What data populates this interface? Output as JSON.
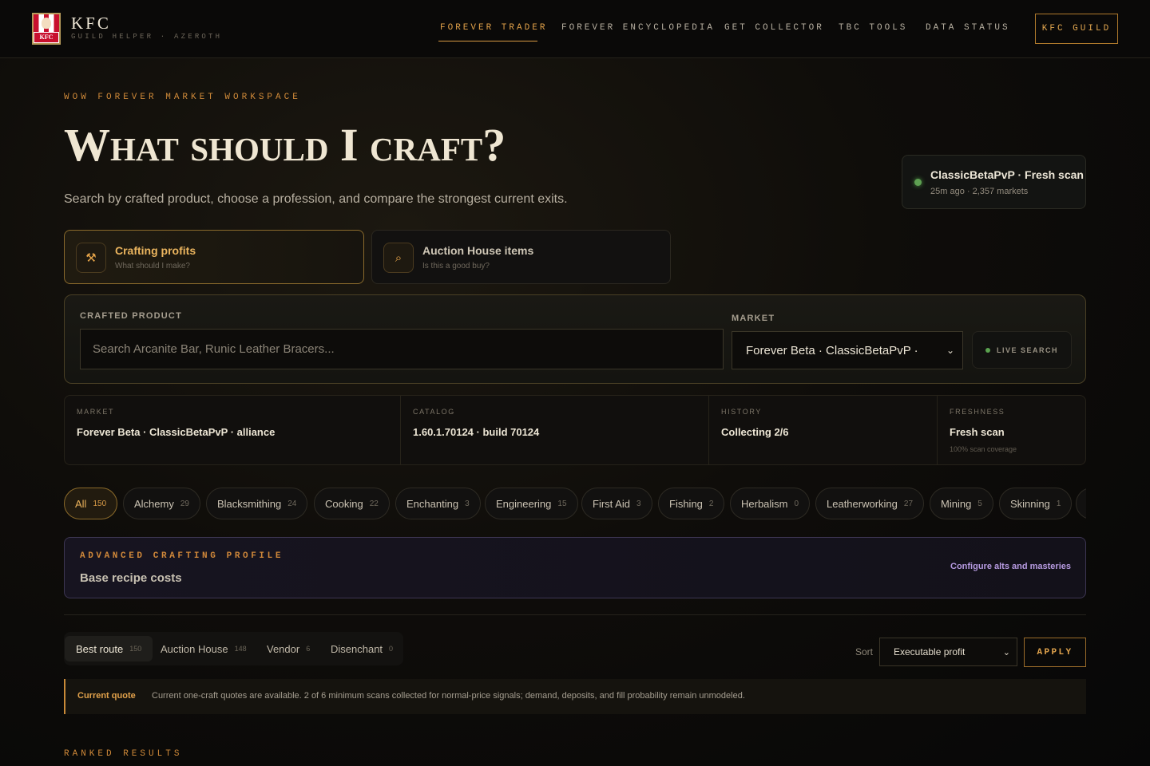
{
  "brand": {
    "logo_text": "KFC",
    "name": "KFC",
    "tagline": "GUILD HELPER · AZEROTH"
  },
  "nav": {
    "items": [
      {
        "label": "FOREVER TRADER",
        "active": true
      },
      {
        "label": "FOREVER ENCYCLOPEDIA",
        "active": false
      },
      {
        "label": "GET COLLECTOR",
        "active": false
      },
      {
        "label": "TBC TOOLS",
        "active": false
      },
      {
        "label": "DATA STATUS",
        "active": false
      }
    ],
    "guild_button": "KFC GUILD"
  },
  "hero": {
    "eyebrow": "WOW FOREVER MARKET WORKSPACE",
    "title": "What should I craft?",
    "subtitle": "Search by crafted product, choose a profession, and compare the strongest current exits."
  },
  "scan_status": {
    "title": "ClassicBetaPvP · Fresh scan",
    "meta": "25m ago · 2,357 markets",
    "status_color": "#5ea052"
  },
  "modes": [
    {
      "title": "Crafting profits",
      "subtitle": "What should I make?",
      "icon": "hammer-pick-icon",
      "glyph": "⚒",
      "active": true
    },
    {
      "title": "Auction House items",
      "subtitle": "Is this a good buy?",
      "icon": "search-icon",
      "glyph": "⌕",
      "active": false
    }
  ],
  "search": {
    "product_label": "CRAFTED PRODUCT",
    "product_placeholder": "Search Arcanite Bar, Runic Leather Bracers...",
    "product_value": "",
    "market_label": "MARKET",
    "market_value": "Forever Beta · ClassicBetaPvP ·",
    "live_label": "LIVE SEARCH"
  },
  "stats": [
    {
      "label": "MARKET",
      "value": "Forever Beta · ClassicBetaPvP · alliance",
      "note": ""
    },
    {
      "label": "CATALOG",
      "value": "1.60.1.70124 · build 70124",
      "note": ""
    },
    {
      "label": "HISTORY",
      "value": "Collecting 2/6",
      "note": ""
    },
    {
      "label": "FRESHNESS",
      "value": "Fresh scan",
      "note": "100% scan coverage"
    }
  ],
  "professions": [
    {
      "label": "All",
      "count": "150",
      "active": true
    },
    {
      "label": "Alchemy",
      "count": "29"
    },
    {
      "label": "Blacksmithing",
      "count": "24"
    },
    {
      "label": "Cooking",
      "count": "22"
    },
    {
      "label": "Enchanting",
      "count": "3"
    },
    {
      "label": "Engineering",
      "count": "15"
    },
    {
      "label": "First Aid",
      "count": "3"
    },
    {
      "label": "Fishing",
      "count": "2"
    },
    {
      "label": "Herbalism",
      "count": "0"
    },
    {
      "label": "Leatherworking",
      "count": "27"
    },
    {
      "label": "Mining",
      "count": "5"
    },
    {
      "label": "Skinning",
      "count": "1"
    },
    {
      "label": "",
      "count": ""
    }
  ],
  "profile": {
    "eyebrow": "ADVANCED CRAFTING PROFILE",
    "title": "Base recipe costs",
    "link": "Configure alts and masteries"
  },
  "routes": [
    {
      "label": "Best route",
      "count": "150",
      "active": true
    },
    {
      "label": "Auction House",
      "count": "148"
    },
    {
      "label": "Vendor",
      "count": "6"
    },
    {
      "label": "Disenchant",
      "count": "0"
    }
  ],
  "sort": {
    "label": "Sort",
    "value": "Executable profit",
    "apply": "APPLY"
  },
  "quote": {
    "label": "Current quote",
    "text": "Current one-craft quotes are available. 2 of 6 minimum scans collected for normal-price signals; demand, deposits, and fill probability remain unmodeled."
  },
  "ranked_heading": "RANKED RESULTS",
  "colors": {
    "accent": "#e2a24a",
    "live": "#5aa24f",
    "profile_link": "#b69ae0"
  }
}
